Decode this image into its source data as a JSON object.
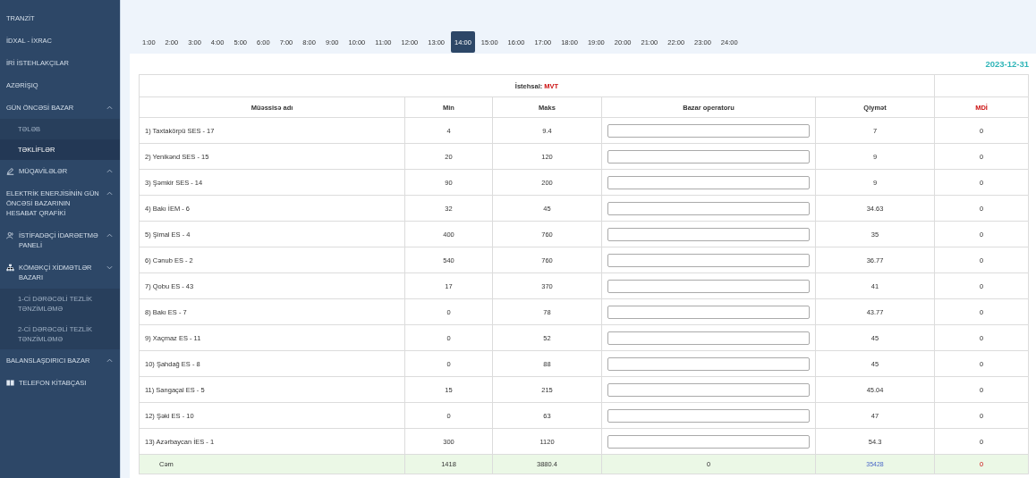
{
  "sidebar": {
    "items": [
      {
        "label": "TRANZİT"
      },
      {
        "label": "İDXAL - İXRAC"
      },
      {
        "label": "İRİ İSTEHLAKÇILAR"
      },
      {
        "label": "AZƏRİŞIQ"
      },
      {
        "label": "GÜN ÖNCƏSİ BAZAR",
        "caret_up": true,
        "children": [
          {
            "label": "TƏLƏB",
            "selected": false
          },
          {
            "label": "TƏKLİFLƏR",
            "selected": true
          }
        ]
      },
      {
        "label": "MÜQAVİLƏLƏR",
        "kind": "pen",
        "caret_up": true
      },
      {
        "label": "ELEKTRİK ENERJİSİNİN GÜN ÖNCƏSİ BAZARININ HESABAT QRAFİKİ",
        "caret_up": true
      },
      {
        "label": "İSTİFADƏÇİ İDARƏETMƏ PANELİ",
        "kind": "users",
        "caret_up": true
      },
      {
        "label": "KÖMƏKÇİ XİDMƏTLƏR BAZARI",
        "kind": "network",
        "caret_up": false,
        "children": [
          {
            "label": "1-Cİ DƏRƏCƏLİ TEZLİK TƏNZİMLƏMƏ",
            "selected": false
          },
          {
            "label": "2-Cİ DƏRƏCƏLİ TEZLİK TƏNZİMLƏMƏ",
            "selected": false
          }
        ]
      },
      {
        "label": "BALANSLAŞDIRICI BAZAR",
        "caret_up": true
      },
      {
        "label": "TELEFON KİTABÇASI",
        "kind": "book"
      }
    ]
  },
  "hours": [
    {
      "label": "1:00",
      "selected": false
    },
    {
      "label": "2:00",
      "selected": false
    },
    {
      "label": "3:00",
      "selected": false
    },
    {
      "label": "4:00",
      "selected": false
    },
    {
      "label": "5:00",
      "selected": false
    },
    {
      "label": "6:00",
      "selected": false
    },
    {
      "label": "7:00",
      "selected": false
    },
    {
      "label": "8:00",
      "selected": false
    },
    {
      "label": "9:00",
      "selected": false
    },
    {
      "label": "10:00",
      "selected": false
    },
    {
      "label": "11:00",
      "selected": false
    },
    {
      "label": "12:00",
      "selected": false
    },
    {
      "label": "13:00",
      "selected": false
    },
    {
      "label": "14:00",
      "selected": true
    },
    {
      "label": "15:00",
      "selected": false
    },
    {
      "label": "16:00",
      "selected": false
    },
    {
      "label": "17:00",
      "selected": false
    },
    {
      "label": "18:00",
      "selected": false
    },
    {
      "label": "19:00",
      "selected": false
    },
    {
      "label": "20:00",
      "selected": false
    },
    {
      "label": "21:00",
      "selected": false
    },
    {
      "label": "22:00",
      "selected": false
    },
    {
      "label": "23:00",
      "selected": false
    },
    {
      "label": "24:00",
      "selected": false
    }
  ],
  "date": "2023-12-31",
  "table": {
    "group_header": {
      "label": "İstehsal:",
      "unit": "MVT"
    },
    "columns": [
      "Müəssisə adı",
      "Min",
      "Maks",
      "Bazar operatoru",
      "Qiymət",
      "MDİ"
    ],
    "rows": [
      [
        "1) Taxtakörpü SES - 17",
        "4",
        "9.4",
        "",
        "7",
        "0"
      ],
      [
        "2) Yenikənd SES - 15",
        "20",
        "120",
        "",
        "9",
        "0"
      ],
      [
        "3) Şəmkir SES - 14",
        "90",
        "200",
        "",
        "9",
        "0"
      ],
      [
        "4) Bakı İEM - 6",
        "32",
        "45",
        "",
        "34.63",
        "0"
      ],
      [
        "5) Şimal ES - 4",
        "400",
        "760",
        "",
        "35",
        "0"
      ],
      [
        "6) Cənub ES - 2",
        "540",
        "760",
        "",
        "36.77",
        "0"
      ],
      [
        "7) Qobu ES - 43",
        "17",
        "370",
        "",
        "41",
        "0"
      ],
      [
        "8) Bakı ES - 7",
        "0",
        "78",
        "",
        "43.77",
        "0"
      ],
      [
        "9) Xaçmaz ES - 11",
        "0",
        "52",
        "",
        "45",
        "0"
      ],
      [
        "10) Şahdağ ES - 8",
        "0",
        "88",
        "",
        "45",
        "0"
      ],
      [
        "11) Sangaçal ES - 5",
        "15",
        "215",
        "",
        "45.04",
        "0"
      ],
      [
        "12) Şəki ES - 10",
        "0",
        "63",
        "",
        "47",
        "0"
      ],
      [
        "13) Azərbaycan İES - 1",
        "300",
        "1120",
        "",
        "54.3",
        "0"
      ]
    ],
    "total": [
      "Cəm",
      "1418",
      "3880.4",
      "0",
      "35428",
      "0"
    ]
  }
}
